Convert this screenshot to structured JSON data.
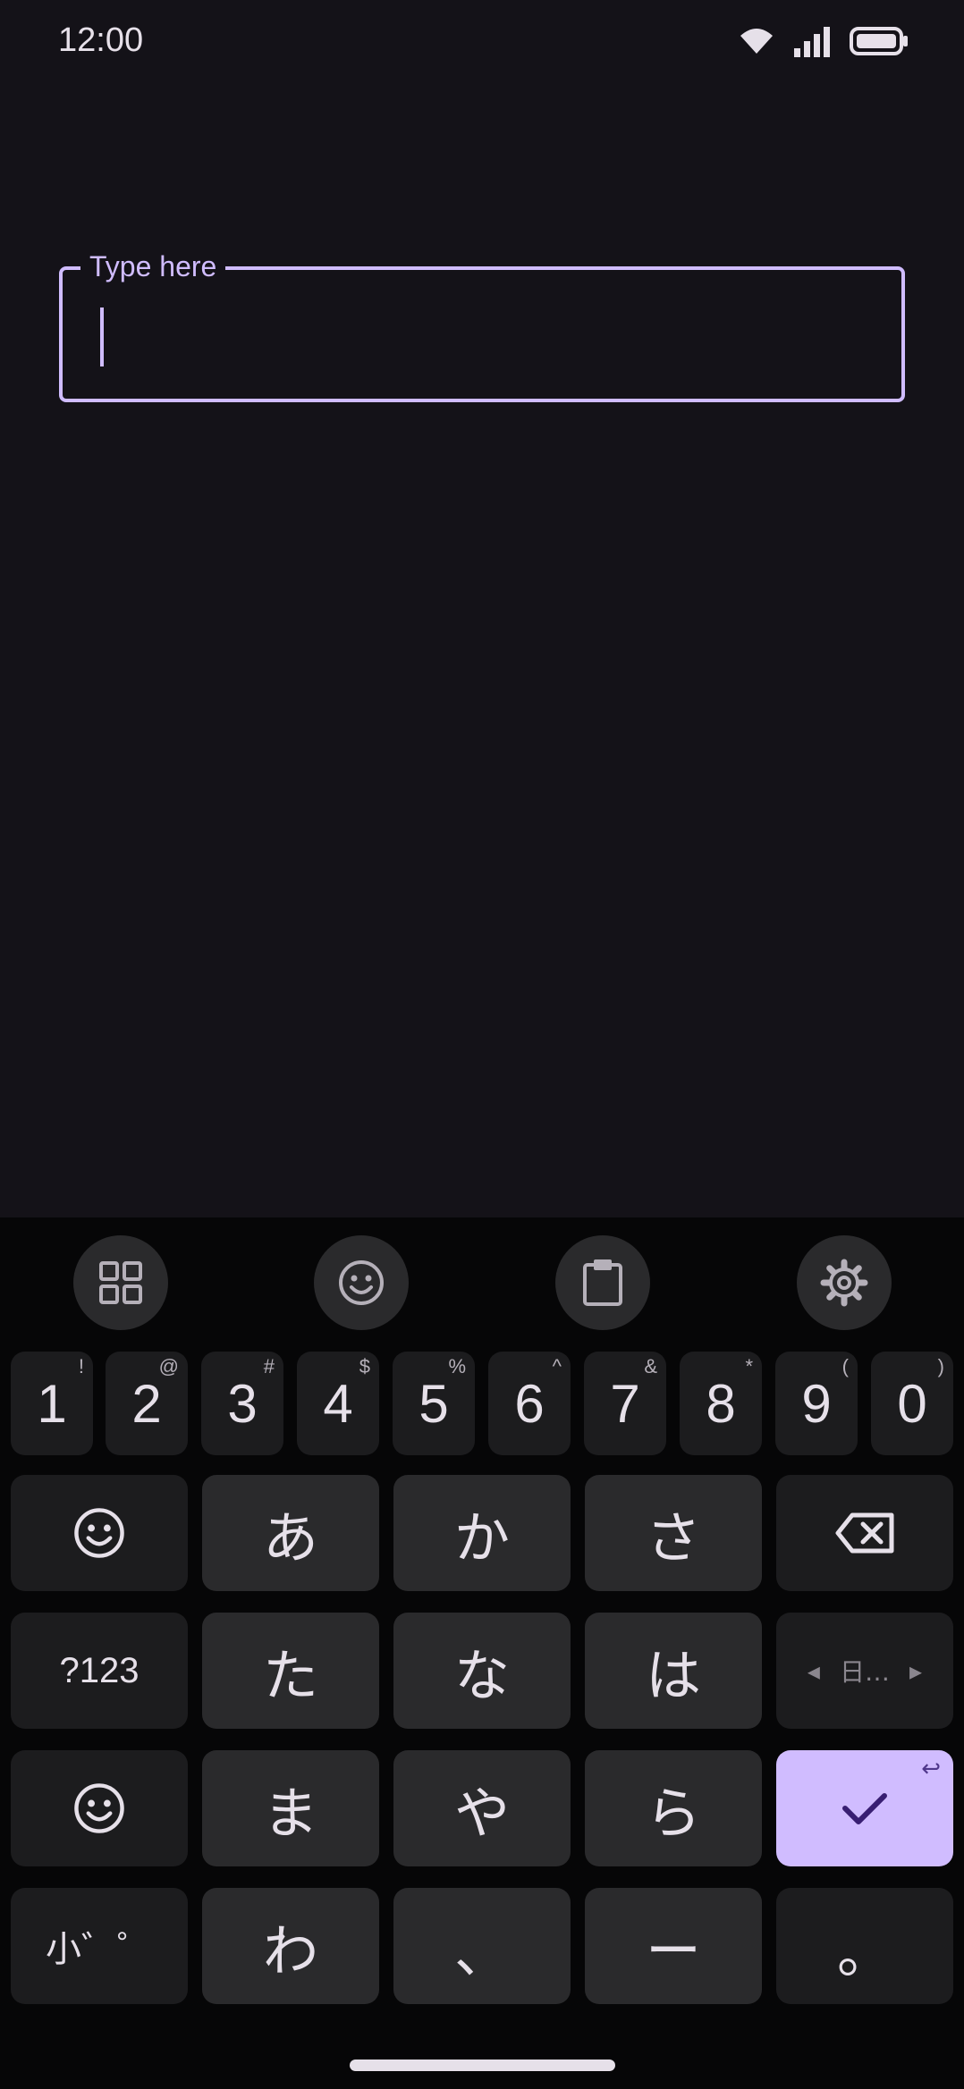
{
  "status": {
    "time": "12:00"
  },
  "field": {
    "label": "Type here"
  },
  "keyboard": {
    "toolbar": [
      "grid-icon",
      "emoji-icon",
      "clipboard-icon",
      "settings-icon"
    ],
    "numbers": [
      {
        "main": "1",
        "sub": "!"
      },
      {
        "main": "2",
        "sub": "@"
      },
      {
        "main": "3",
        "sub": "#"
      },
      {
        "main": "4",
        "sub": "$"
      },
      {
        "main": "5",
        "sub": "%"
      },
      {
        "main": "6",
        "sub": "^"
      },
      {
        "main": "7",
        "sub": "&"
      },
      {
        "main": "8",
        "sub": "*"
      },
      {
        "main": "9",
        "sub": "("
      },
      {
        "main": "0",
        "sub": ")"
      }
    ],
    "kana_row1": [
      "あ",
      "か",
      "さ"
    ],
    "kana_row2": [
      "た",
      "な",
      "は"
    ],
    "kana_row3": [
      "ま",
      "や",
      "ら"
    ],
    "kana_row4": [
      "わ",
      "、",
      "ー",
      "。"
    ],
    "symbols_label": "?123",
    "dakuten_label": "小゛゜",
    "lang_label": "日…",
    "lang_left": "◂",
    "lang_right": "▸",
    "enter_sub": "↩"
  },
  "colors": {
    "accent": "#D0BCFF",
    "background": "#141218",
    "key": "#2A2A2C",
    "key_dark": "#1C1C1E",
    "keyboard_bg": "#060607"
  }
}
